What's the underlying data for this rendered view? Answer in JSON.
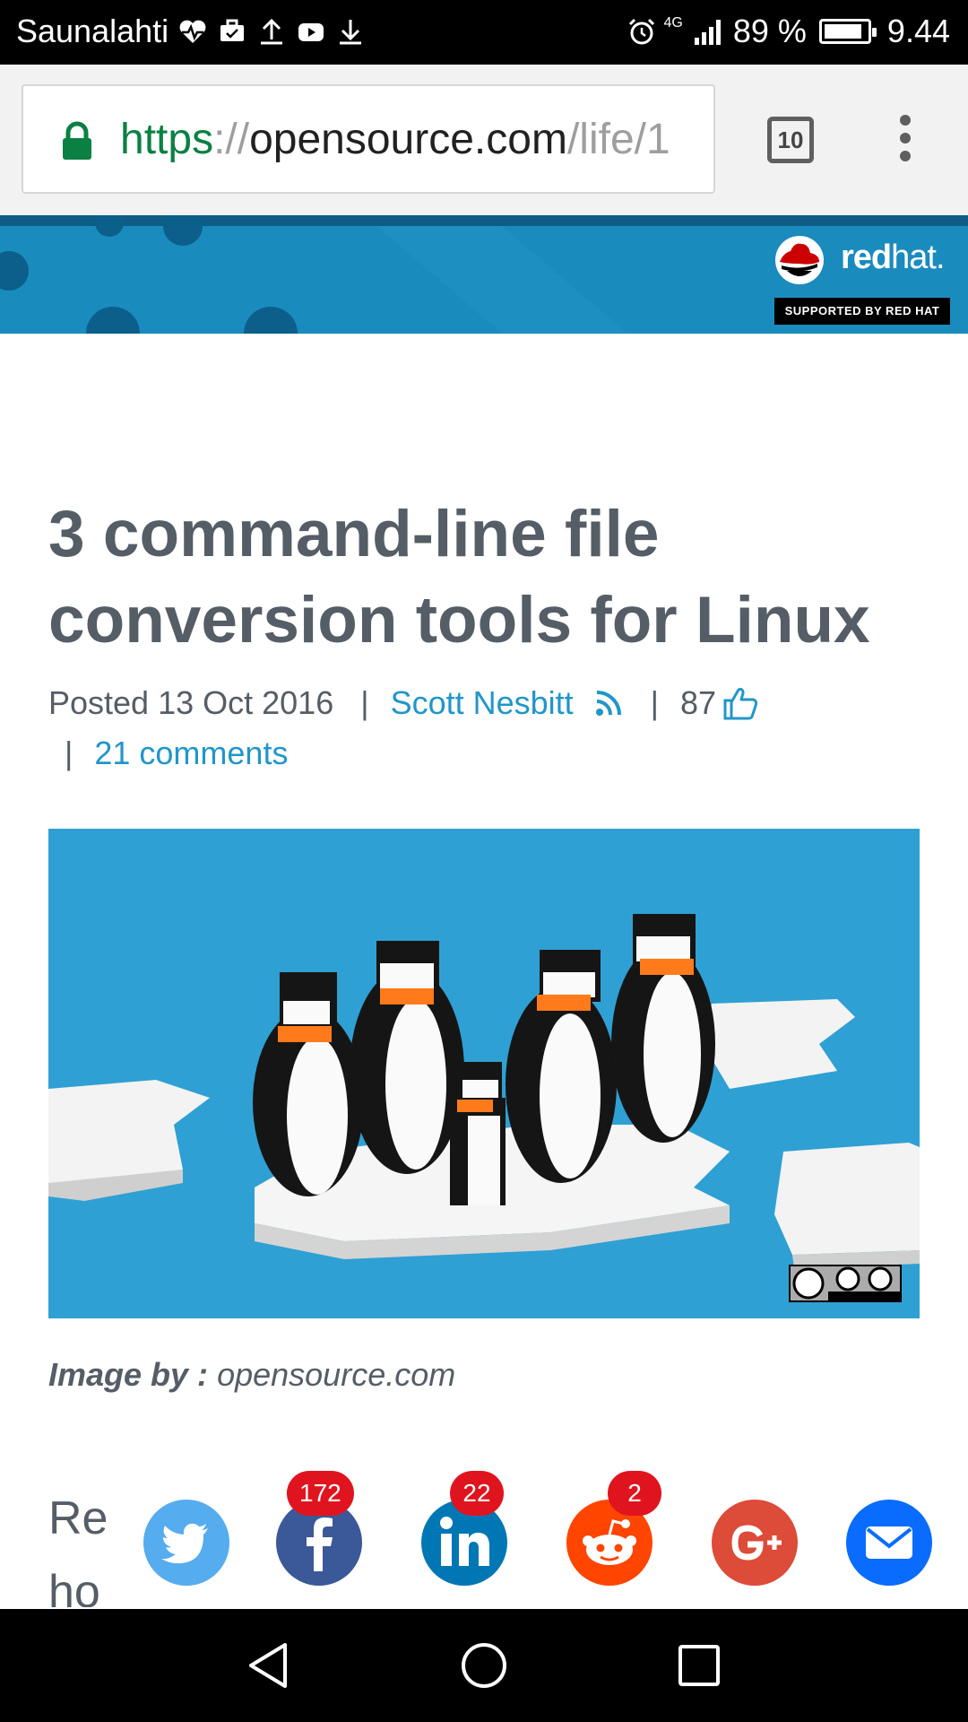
{
  "status_bar": {
    "carrier": "Saunalahti",
    "network": "4G",
    "battery": "89 %",
    "battery_level": 0.89,
    "time": "9.44",
    "icons": [
      "heartbeat-icon",
      "briefcase-icon",
      "upload-icon",
      "youtube-icon",
      "download-icon",
      "alarm-icon",
      "signal-icon",
      "battery-icon"
    ]
  },
  "browser": {
    "url_scheme": "https",
    "url_sep": "://",
    "url_host": "opensource.com",
    "url_path": "/life/1",
    "tab_count": "10"
  },
  "banner": {
    "brand": "redhat.",
    "brand_bold": "red",
    "brand_light": "hat.",
    "tagline": "SUPPORTED BY RED HAT",
    "colors": {
      "background": "#1a8bbd",
      "dark": "#0d5d85"
    }
  },
  "article": {
    "title": "3 command-line file conversion tools for Linux",
    "posted": "Posted 13 Oct 2016",
    "author": "Scott Nesbitt",
    "likes": "87",
    "comments": "21 comments",
    "image_caption_label": "Image by :",
    "image_caption_source": "opensource.com",
    "body_line1": "Re",
    "body_line2": "ho"
  },
  "share": {
    "items": [
      {
        "name": "twitter",
        "count": "",
        "color": "#55acee"
      },
      {
        "name": "facebook",
        "count": "172",
        "color": "#3b5998"
      },
      {
        "name": "linkedin",
        "count": "22",
        "color": "#0077b5"
      },
      {
        "name": "reddit",
        "count": "2",
        "color": "#ff4500"
      },
      {
        "name": "google-plus",
        "count": "",
        "color": "#dd4b39"
      },
      {
        "name": "email",
        "count": "",
        "color": "#0a6cff"
      }
    ]
  },
  "colors": {
    "link": "#2196c9",
    "text": "#555d66",
    "badge": "#e0141e"
  }
}
